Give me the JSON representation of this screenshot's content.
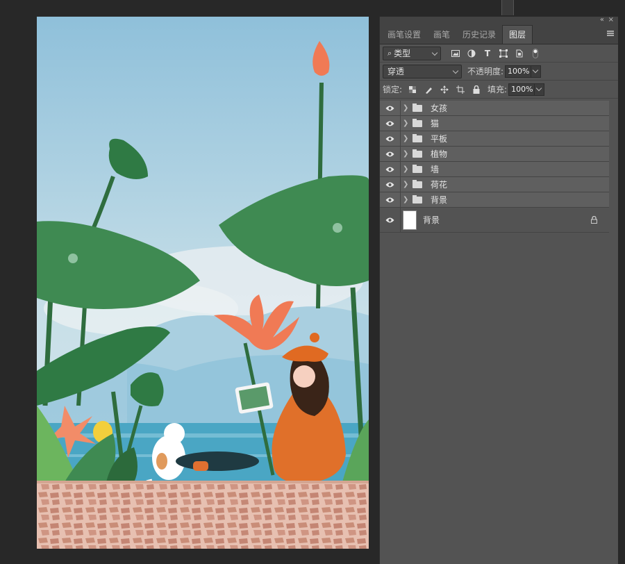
{
  "panel": {
    "tabs": [
      "画笔设置",
      "画笔",
      "历史记录",
      "图层"
    ],
    "active_tab": "图层",
    "filter": {
      "value": "类型"
    },
    "blend_mode": {
      "value": "穿透"
    },
    "opacity": {
      "label": "不透明度:",
      "value": "100%"
    },
    "lock": {
      "label": "锁定:"
    },
    "fill": {
      "label": "填充:",
      "value": "100%"
    },
    "layers": [
      {
        "name": "女孩",
        "type": "group",
        "visible": true
      },
      {
        "name": "猫",
        "type": "group",
        "visible": true
      },
      {
        "name": "平板",
        "type": "group",
        "visible": true
      },
      {
        "name": "植物",
        "type": "group",
        "visible": true
      },
      {
        "name": "墙",
        "type": "group",
        "visible": true
      },
      {
        "name": "荷花",
        "type": "group",
        "visible": true
      },
      {
        "name": "背景",
        "type": "group",
        "visible": true
      }
    ],
    "background_layer": {
      "name": "背景",
      "locked": true,
      "visible": true
    }
  },
  "colors": {
    "app_bg": "#282828",
    "panel_bg": "#535353",
    "sky": "#9dc6dc",
    "leaf": "#3f8a52",
    "lotus": "#f07a55",
    "girl_sweater": "#e0702a",
    "wall": "#e6b3a3"
  }
}
